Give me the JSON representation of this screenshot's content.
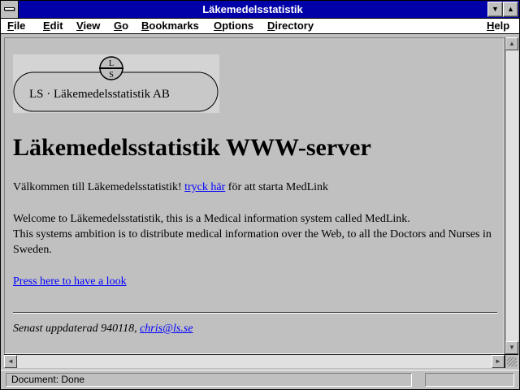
{
  "window": {
    "title": "Läkemedelsstatistik",
    "minimize_glyph": "▼",
    "maximize_glyph": "▲"
  },
  "menubar": {
    "items": [
      {
        "key": "F",
        "rest": "ile"
      },
      {
        "key": "E",
        "rest": "dit"
      },
      {
        "key": "V",
        "rest": "iew"
      },
      {
        "key": "G",
        "rest": "o"
      },
      {
        "key": "B",
        "rest": "ookmarks"
      },
      {
        "key": "O",
        "rest": "ptions"
      },
      {
        "key": "D",
        "rest": "irectory"
      },
      {
        "key": "H",
        "rest": "elp"
      }
    ]
  },
  "page": {
    "logo": {
      "top_letter": "L",
      "bottom_letter": "S",
      "text": "LS · Läkemedelsstatistik AB"
    },
    "heading": "Läkemedelsstatistik WWW-server",
    "welcome_sv": {
      "before": "Välkommen till Läkemedelsstatistik! ",
      "link": "tryck här",
      "after": " för att starta MedLink"
    },
    "welcome_en_line1": "Welcome to Läkemedelsstatistik, this is a Medical information system called MedLink.",
    "welcome_en_line2": "This systems ambition is to distribute medical information over the Web, to all the Doctors and Nurses in Sweden.",
    "look_link": "Press here to have a look",
    "footer": {
      "text": "Senast uppdaterad 940118, ",
      "email": "chris@ls.se"
    }
  },
  "scrollbars": {
    "up_glyph": "▲",
    "down_glyph": "▼",
    "left_glyph": "◄",
    "right_glyph": "►"
  },
  "status": {
    "text": "Document: Done"
  },
  "colors": {
    "titlebar": "#0000a8",
    "link": "#0000ff",
    "background": "#c0c0c0"
  }
}
